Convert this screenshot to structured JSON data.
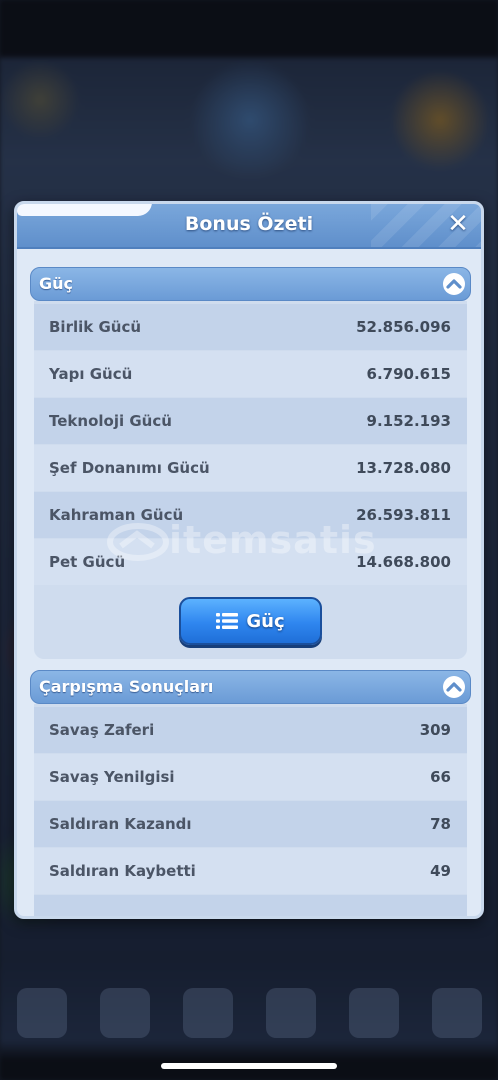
{
  "modal": {
    "title": "Bonus Özeti"
  },
  "power_section": {
    "title": "Güç",
    "rows": [
      {
        "label": "Birlik Gücü",
        "value": "52.856.096"
      },
      {
        "label": "Yapı Gücü",
        "value": "6.790.615"
      },
      {
        "label": "Teknoloji Gücü",
        "value": "9.152.193"
      },
      {
        "label": "Şef Donanımı Gücü",
        "value": "13.728.080"
      },
      {
        "label": "Kahraman Gücü",
        "value": "26.593.811"
      },
      {
        "label": "Pet Gücü",
        "value": "14.668.800"
      }
    ],
    "button_label": "Güç"
  },
  "combat_section": {
    "title": "Çarpışma Sonuçları",
    "rows": [
      {
        "label": "Savaş Zaferi",
        "value": "309"
      },
      {
        "label": "Savaş Yenilgisi",
        "value": "66"
      },
      {
        "label": "Saldıran Kazandı",
        "value": "78"
      },
      {
        "label": "Saldıran Kaybetti",
        "value": "49"
      }
    ]
  },
  "watermark": "itemsatis",
  "icons": {
    "close": "close-icon",
    "collapse": "chevron-up-icon",
    "list": "list-icon"
  }
}
